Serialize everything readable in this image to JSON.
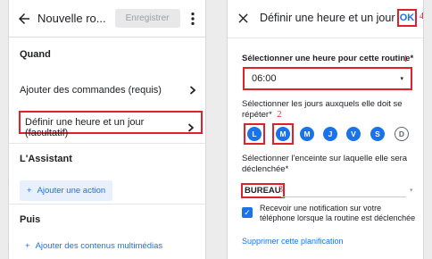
{
  "left": {
    "title": "Nouvelle ro...",
    "save_label": "Enregistrer",
    "section_when": "Quand",
    "add_commands": "Ajouter des commandes (requis)",
    "set_time": "Définir une heure et un jour (facultatif)",
    "section_assistant": "L'Assistant",
    "add_action": "Ajouter une action",
    "section_then": "Puis",
    "add_media": "Ajouter des contenus multimédias"
  },
  "right": {
    "title": "Définir une heure et un jour",
    "ok_label": "OK",
    "time_label": "Sélectionner une heure pour cette routine*",
    "time_value": "06:00",
    "days_label": "Sélectionner les jours auxquels elle doit se répéter*",
    "days": [
      {
        "letter": "L",
        "selected": true
      },
      {
        "letter": "M",
        "selected": true
      },
      {
        "letter": "M",
        "selected": true
      },
      {
        "letter": "J",
        "selected": true
      },
      {
        "letter": "V",
        "selected": true
      },
      {
        "letter": "S",
        "selected": true
      },
      {
        "letter": "D",
        "selected": false
      }
    ],
    "speaker_label": "Sélectionner l'enceinte sur laquelle elle sera déclenchée*",
    "speaker_value": "BUREAU",
    "notification_text": "Recevoir une notification sur votre téléphone lorsque la routine est déclenchée",
    "notification_checked": true,
    "delete_label": "Supprimer cette planification"
  },
  "annotations": {
    "n1": "1",
    "n2": "2",
    "n3": "3",
    "n4": "4"
  },
  "colors": {
    "accent": "#1a73e8",
    "highlight": "#e0202a"
  }
}
